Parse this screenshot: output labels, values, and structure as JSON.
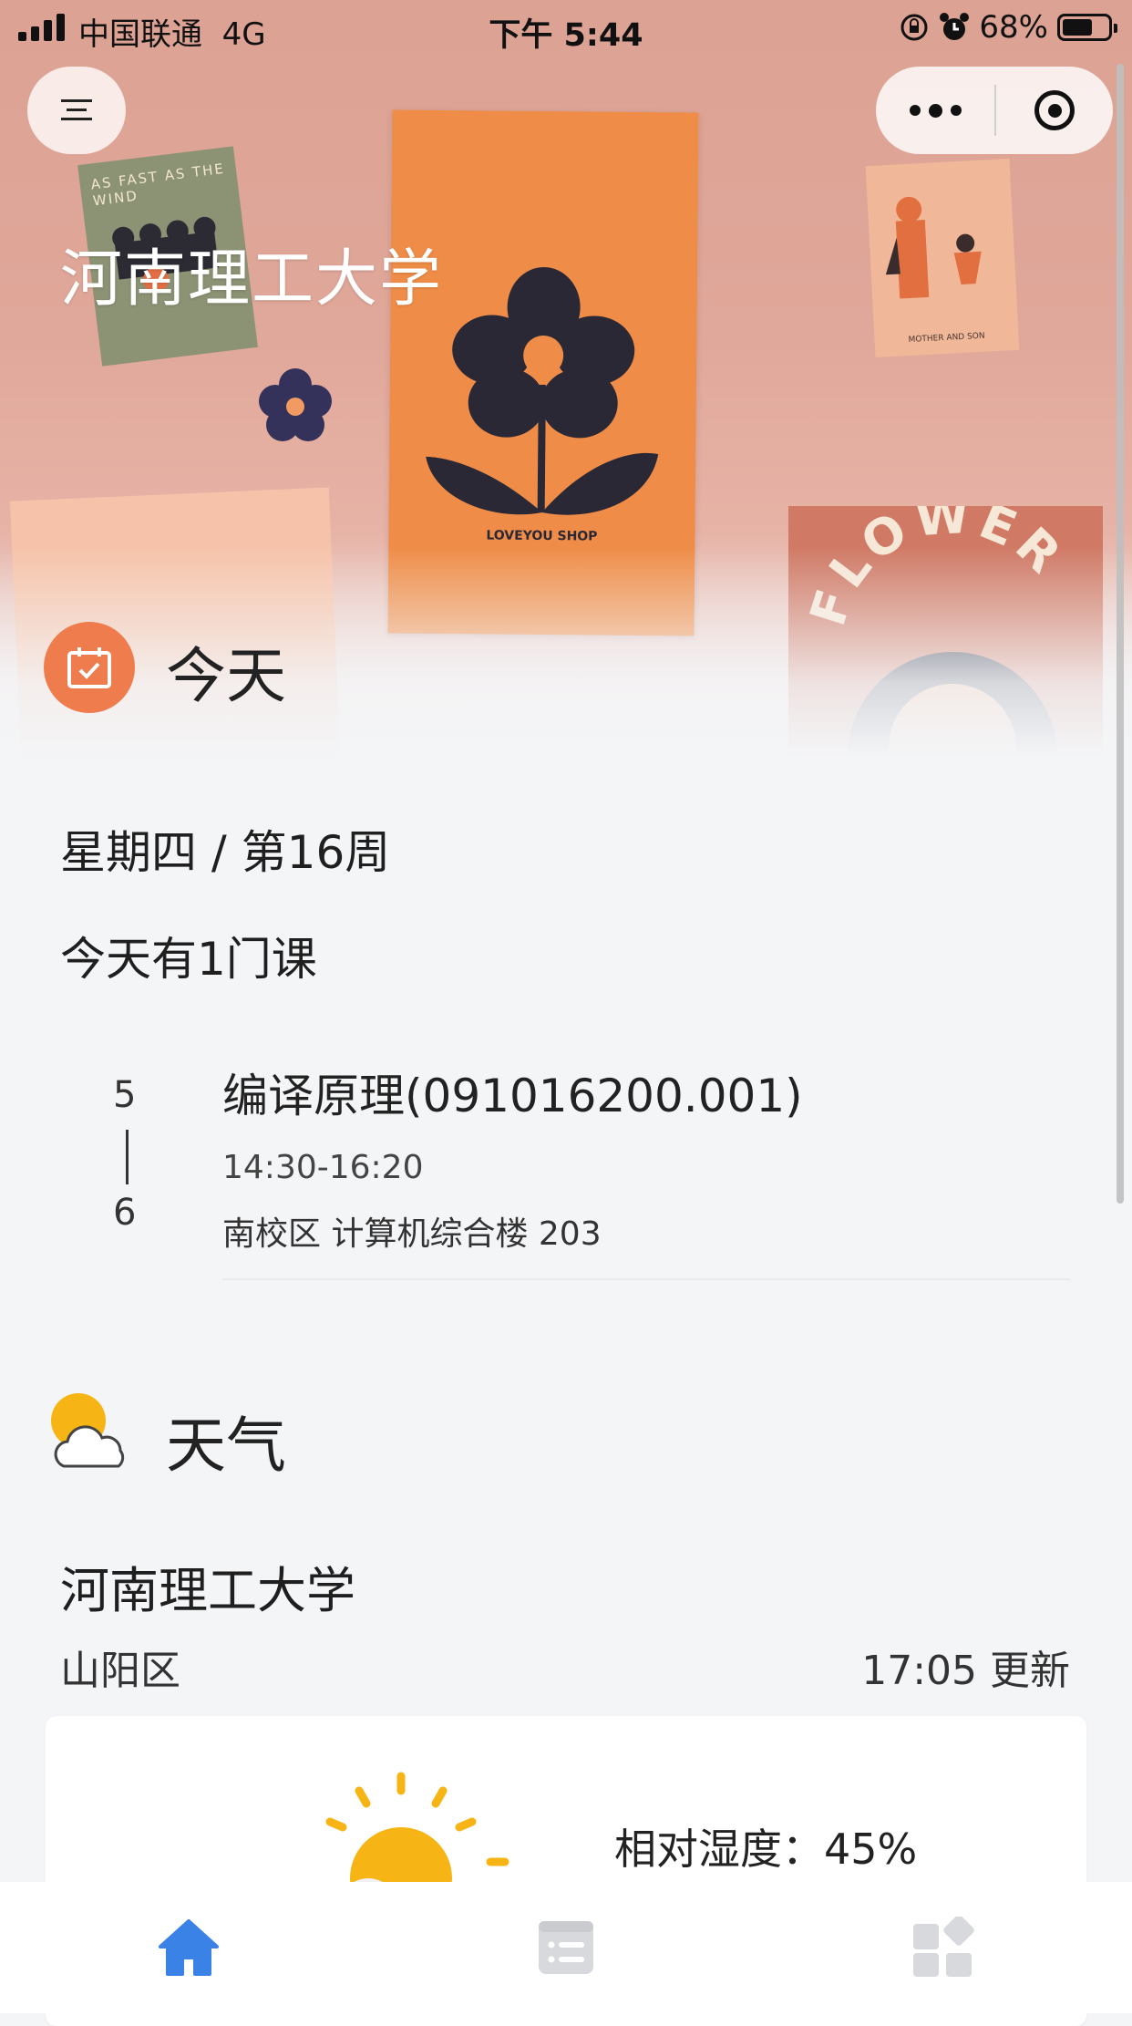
{
  "status_bar": {
    "carrier": "中国联通",
    "network": "4G",
    "time": "下午 5:44",
    "battery": "68%"
  },
  "capsule": {
    "menu_icon": "menu-icon",
    "more_icon": "more-dots-icon",
    "close_icon": "target-close-icon"
  },
  "hero": {
    "title": "河南理工大学",
    "poster_texts": [
      "AS FAST AS THE WIND",
      "LOVEYOU SHOP",
      "MOTHER AND SON",
      "FLOWER"
    ]
  },
  "today": {
    "title": "今天",
    "icon": "calendar-check-icon",
    "week_line": "星期四 / 第16周",
    "course_count": "今天有1门课",
    "courses": [
      {
        "period_start": "5",
        "period_end": "6",
        "name": "编译原理(091016200.001)",
        "time": "14:30-16:20",
        "room": "南校区 计算机综合楼 203"
      }
    ]
  },
  "weather": {
    "title": "天气",
    "icon": "sun-cloud-icon",
    "location": "河南理工大学",
    "district": "山阳区",
    "updated": "17:05 更新",
    "humidity": "相对湿度：45%"
  },
  "tabs": [
    {
      "name": "home",
      "icon": "home-icon",
      "active": true
    },
    {
      "name": "list",
      "icon": "list-icon",
      "active": false
    },
    {
      "name": "apps",
      "icon": "apps-grid-icon",
      "active": false
    }
  ],
  "colors": {
    "accent_orange": "#ee7c4c",
    "active_tab": "#3b82e6",
    "inactive_tab": "#d7d9dc"
  }
}
